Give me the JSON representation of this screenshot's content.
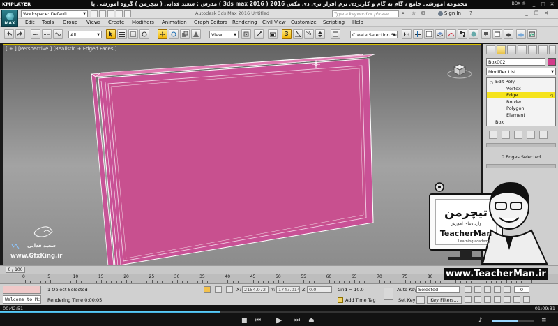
{
  "player": {
    "name": "KMPLAYER",
    "caption": "مجموعه آموزشی جامع ، گام به گام و کاربردی نرم افزار تری دی مکس 2016 ( 3ds max 2016 )  مدرس : سعید فدایی ( تیچرمن ) گروه آموزشی پادشاه گرافیست ها",
    "box_label": "BOX ®",
    "minimize": "_",
    "maximize": "□",
    "close": "✕",
    "time_elapsed": "00:42:51",
    "time_total": "01:09:31",
    "progress": 0.395,
    "volume": 0.62,
    "tags": [
      "3D",
      "AUTO",
      "DXVA",
      "FPS"
    ]
  },
  "max": {
    "app_button_label": "MAX",
    "workspace": "Workspace: Default",
    "title": "Autodesk 3ds Max 2016    Untitled",
    "search_placeholder": "Type a keyword or phrase",
    "signin": "Sign In",
    "menu": [
      "Edit",
      "Tools",
      "Group",
      "Views",
      "Create",
      "Modifiers",
      "Animation",
      "Graph Editors",
      "Rendering",
      "Civil View",
      "Customize",
      "Scripting",
      "Help"
    ],
    "toolbar": {
      "filter": "All",
      "refcoord": "View",
      "selection_set": "Create Selection Se",
      "snap_label": "3"
    },
    "viewport_label": "[ + ] [Perspective ] [Realistic + Edged Faces ]"
  },
  "command_panel": {
    "object_name": "Box002",
    "object_color": "#d13c8a",
    "modifier_list": "Modifier List",
    "stack": [
      {
        "label": "Edit Poly",
        "level": 0,
        "selected": false
      },
      {
        "label": "Vertex",
        "level": 1,
        "selected": false
      },
      {
        "label": "Edge",
        "level": 1,
        "selected": true
      },
      {
        "label": "Border",
        "level": 1,
        "selected": false
      },
      {
        "label": "Polygon",
        "level": 1,
        "selected": false
      },
      {
        "label": "Element",
        "level": 1,
        "selected": false
      },
      {
        "label": "Box",
        "level": 0,
        "selected": false
      }
    ],
    "selection_info": "0 Edges Selected"
  },
  "watermark": {
    "signature": "سعید فدایی",
    "url": "www.GfxKing.ir",
    "badge_persian": "تیچرمن",
    "badge_sub": "وارد دنیای آموزش",
    "badge_name": "TeacherMan",
    "badge_small": "Learning academy",
    "teacher_url": "www.TeacherMan.ir"
  },
  "timeline": {
    "slider": "0 / 100",
    "ticks": [
      "0",
      "5",
      "10",
      "15",
      "20",
      "25",
      "30",
      "35",
      "40",
      "45",
      "50",
      "55",
      "60",
      "65",
      "70",
      "75",
      "80",
      "85",
      "90",
      "95",
      "100"
    ]
  },
  "status": {
    "maxscript_label": "",
    "welcome": "Welcome to M:",
    "selected": "1 Object Selected",
    "rendering_time": "Rendering Time  0:00:05",
    "x_label": "X:",
    "x_value": "2154.072",
    "y_label": "Y:",
    "y_value": "1747.014",
    "z_label": "Z:",
    "z_value": "0.0",
    "grid": "Grid = 10.0",
    "add_time_tag": "Add Time Tag",
    "auto_key": "Auto Key",
    "set_key": "Set Key",
    "selected_dd": "Selected",
    "key_filters": "Key Filters...",
    "frame": "0"
  }
}
